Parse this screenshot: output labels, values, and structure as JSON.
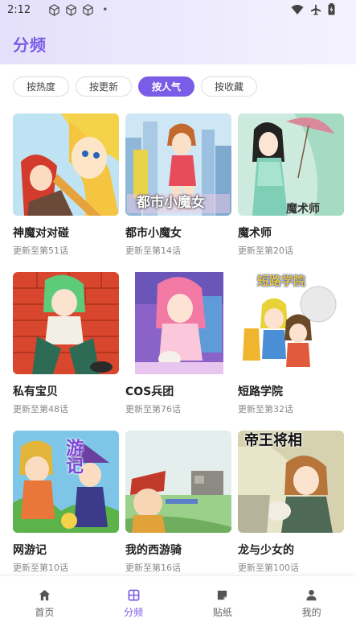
{
  "status": {
    "time": "2:12",
    "dot": "•"
  },
  "header": {
    "title": "分频"
  },
  "sort": [
    {
      "label": "按热度",
      "active": false
    },
    {
      "label": "按更新",
      "active": false
    },
    {
      "label": "按人气",
      "active": true
    },
    {
      "label": "按收藏",
      "active": false
    }
  ],
  "comics": [
    {
      "title": "神魔对对碰",
      "update": "更新至第51话"
    },
    {
      "title": "都市小魔女",
      "update": "更新至第14话",
      "cover_text": "都市小魔女"
    },
    {
      "title": "魔术师",
      "update": "更新至第20话",
      "cover_text": "魔术师"
    },
    {
      "title": "私有宝贝",
      "update": "更新至第48话"
    },
    {
      "title": "COS兵团",
      "update": "更新至第76话"
    },
    {
      "title": "短路学院",
      "update": "更新至第32话",
      "cover_text": "短路学院"
    },
    {
      "title": "网游记",
      "update": "更新至第10话",
      "cover_text": "游记"
    },
    {
      "title": "我的西游骑",
      "update": "更新至第16话"
    },
    {
      "title": "龙与少女的",
      "update": "更新至第100话",
      "cover_text": "帝王将相"
    }
  ],
  "tabs": [
    {
      "label": "首页",
      "icon": "home-icon",
      "active": false
    },
    {
      "label": "分频",
      "icon": "grid-icon",
      "active": true
    },
    {
      "label": "贴纸",
      "icon": "sticker-icon",
      "active": false
    },
    {
      "label": "我的",
      "icon": "user-icon",
      "active": false
    }
  ],
  "colors": {
    "accent": "#7b5ce6"
  }
}
